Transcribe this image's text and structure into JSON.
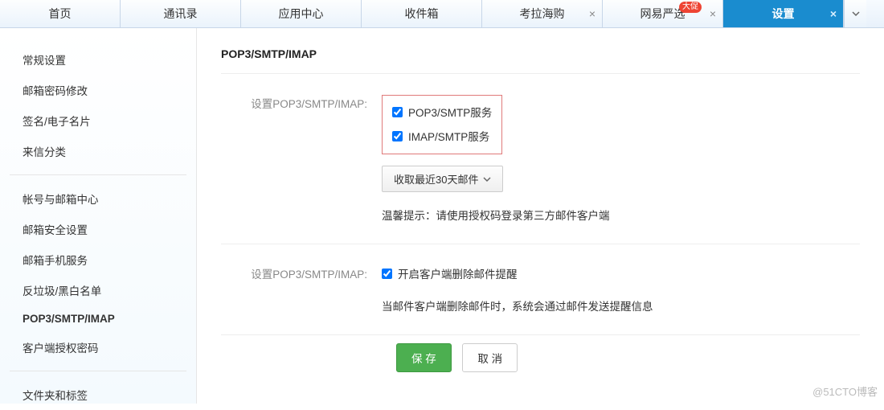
{
  "tabs": {
    "home": "首页",
    "contacts": "通讯录",
    "apps": "应用中心",
    "inbox": "收件箱",
    "kaola": "考拉海购",
    "yanxuan": "网易严选",
    "yanxuan_badge": "大促",
    "settings": "设置"
  },
  "sidebar": {
    "general": "常规设置",
    "password": "邮箱密码修改",
    "signature": "签名/电子名片",
    "incoming": "来信分类",
    "account": "帐号与邮箱中心",
    "security": "邮箱安全设置",
    "mobile": "邮箱手机服务",
    "spam": "反垃圾/黑白名单",
    "protocol": "POP3/SMTP/IMAP",
    "authcode": "客户端授权密码",
    "folders": "文件夹和标签"
  },
  "main": {
    "title": "POP3/SMTP/IMAP",
    "section1": {
      "label": "设置POP3/SMTP/IMAP:",
      "chk_pop3": "POP3/SMTP服务",
      "chk_imap": "IMAP/SMTP服务",
      "dropdown": "收取最近30天邮件",
      "hint": "温馨提示：请使用授权码登录第三方邮件客户端"
    },
    "section2": {
      "label": "设置POP3/SMTP/IMAP:",
      "chk_delete": "开启客户端删除邮件提醒",
      "desc": "当邮件客户端删除邮件时，系统会通过邮件发送提醒信息"
    },
    "save": "保 存",
    "cancel": "取 消"
  },
  "watermark": "@51CTO博客"
}
